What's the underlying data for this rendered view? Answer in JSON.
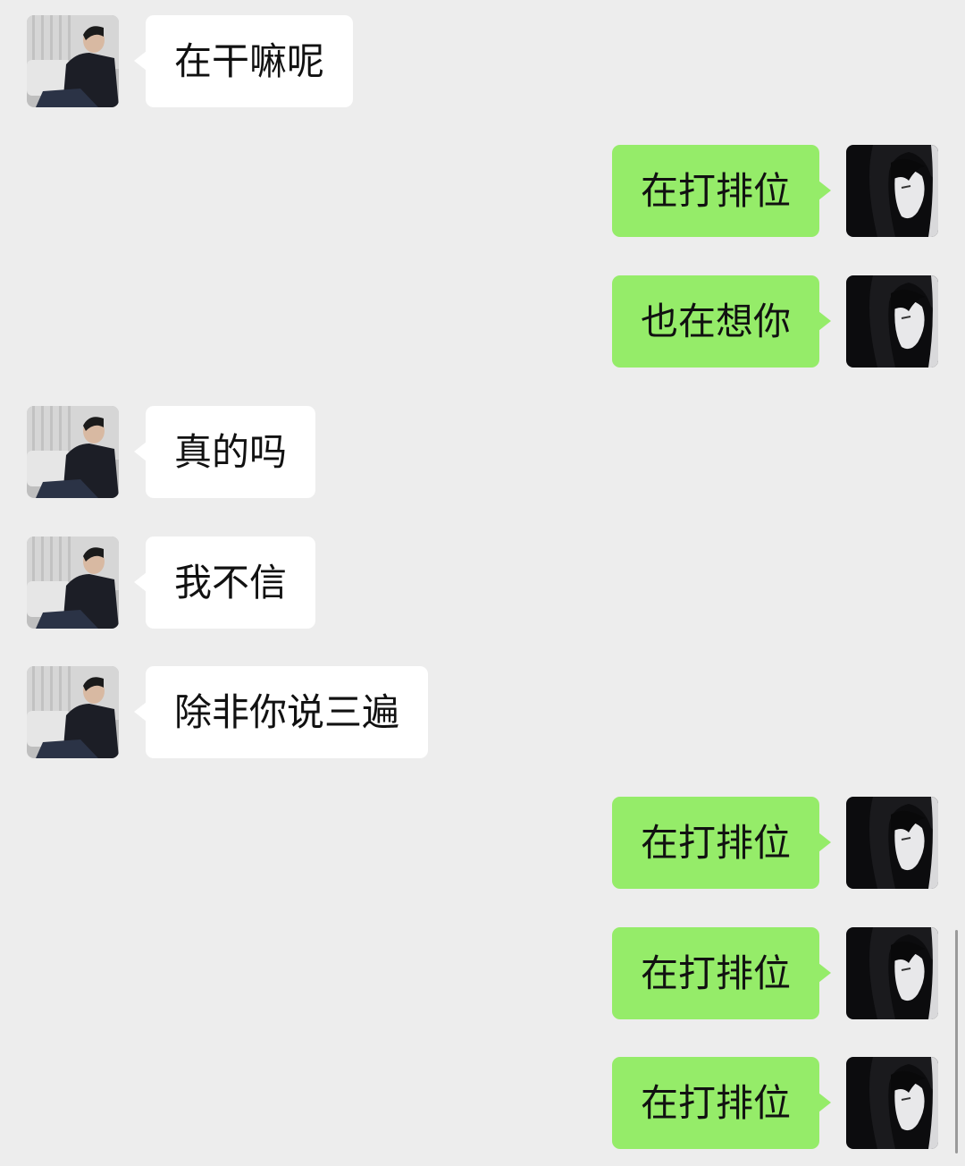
{
  "messages": [
    {
      "side": "left",
      "text": "在干嘛呢"
    },
    {
      "side": "right",
      "text": "在打排位"
    },
    {
      "side": "right",
      "text": "也在想你"
    },
    {
      "side": "left",
      "text": "真的吗"
    },
    {
      "side": "left",
      "text": "我不信"
    },
    {
      "side": "left",
      "text": "除非你说三遍"
    },
    {
      "side": "right",
      "text": "在打排位"
    },
    {
      "side": "right",
      "text": "在打排位"
    },
    {
      "side": "right",
      "text": "在打排位"
    }
  ],
  "colors": {
    "background": "#ededed",
    "incoming_bubble": "#ffffff",
    "outgoing_bubble": "#95ec69"
  },
  "icons": {
    "incoming_avatar": "avatar-man-photo",
    "outgoing_avatar": "avatar-anime-girl"
  }
}
